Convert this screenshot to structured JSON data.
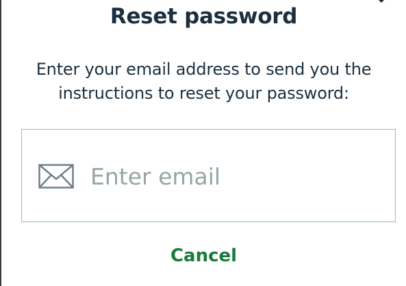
{
  "dialog": {
    "title": "Reset password",
    "description": "Enter your email address to send you the instructions to reset your password:",
    "email_field": {
      "placeholder": "Enter email",
      "value": "",
      "icon": "envelope-icon"
    },
    "cancel_label": "Cancel",
    "close_icon": "close-icon"
  },
  "colors": {
    "title_text": "#1c2f3e",
    "field_border": "#8fc1b2",
    "placeholder": "#97a6a5",
    "cancel_link": "#1a7a3c",
    "icon": "#6f8185"
  }
}
